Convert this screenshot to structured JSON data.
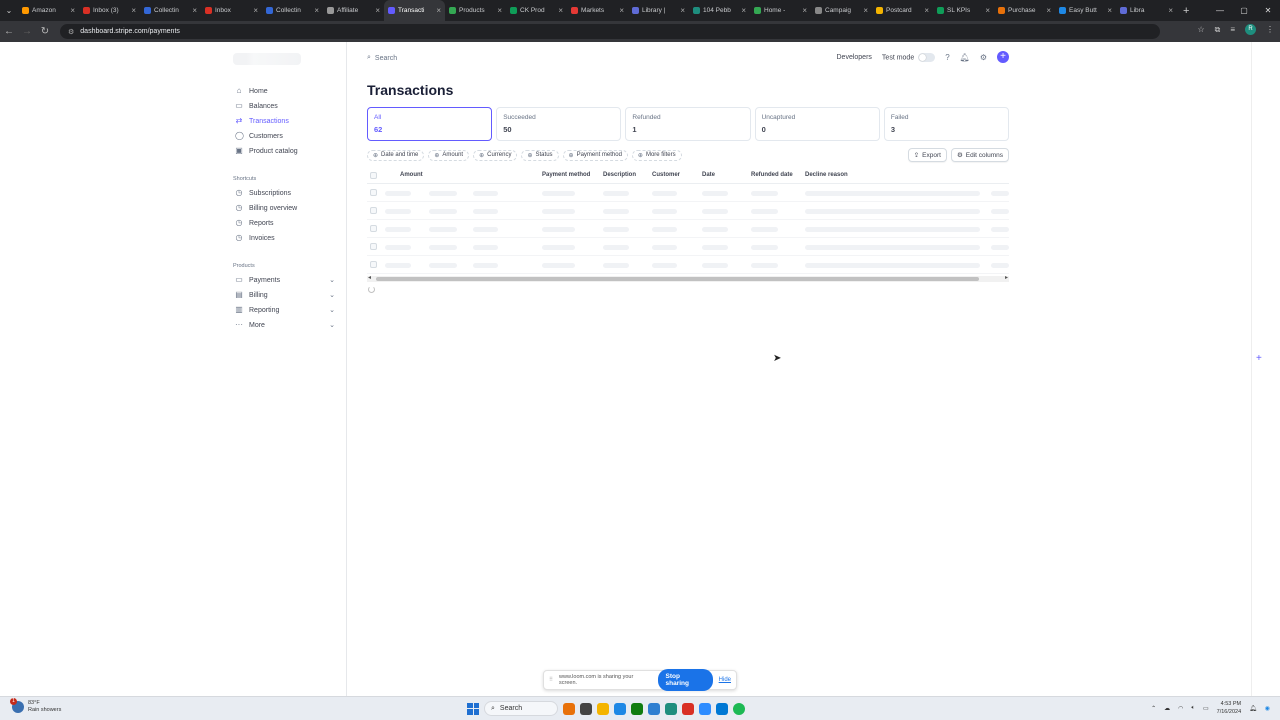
{
  "browser": {
    "tabs": [
      {
        "label": "Amazon",
        "color": "#ff9900"
      },
      {
        "label": "Inbox (3)",
        "color": "#d93025"
      },
      {
        "label": "Collectin",
        "color": "#3367d6"
      },
      {
        "label": "Inbox",
        "color": "#d93025"
      },
      {
        "label": "Collectin",
        "color": "#3367d6"
      },
      {
        "label": "Affiliate",
        "color": "#999999"
      },
      {
        "label": "Transacti",
        "color": "#635bff"
      },
      {
        "label": "Products",
        "color": "#34a853"
      },
      {
        "label": "CK Prod",
        "color": "#0f9d58"
      },
      {
        "label": "Markets",
        "color": "#e53935"
      },
      {
        "label": "Library |",
        "color": "#5f6bd6"
      },
      {
        "label": "104 Pebb",
        "color": "#1e8e7e"
      },
      {
        "label": "Home -",
        "color": "#34a853"
      },
      {
        "label": "Campaig",
        "color": "#888888"
      },
      {
        "label": "Postcard",
        "color": "#f4b400"
      },
      {
        "label": "SL KPIs",
        "color": "#0f9d58"
      },
      {
        "label": "Purchase",
        "color": "#e8710a"
      },
      {
        "label": "Easy Butt",
        "color": "#1e88e5"
      },
      {
        "label": "Libra",
        "color": "#5f6bd6"
      }
    ],
    "active_tab_index": 6,
    "url": "dashboard.stripe.com/payments"
  },
  "sidebar": {
    "main_items": [
      {
        "label": "Home",
        "icon": "home-icon",
        "glyph": "⌂"
      },
      {
        "label": "Balances",
        "icon": "balances-icon",
        "glyph": "▭"
      },
      {
        "label": "Transactions",
        "icon": "transactions-icon",
        "glyph": "⇄"
      },
      {
        "label": "Customers",
        "icon": "customers-icon",
        "glyph": "◯"
      },
      {
        "label": "Product catalog",
        "icon": "catalog-icon",
        "glyph": "▣"
      }
    ],
    "shortcuts_label": "Shortcuts",
    "shortcuts": [
      {
        "label": "Subscriptions"
      },
      {
        "label": "Billing overview"
      },
      {
        "label": "Reports"
      },
      {
        "label": "Invoices"
      }
    ],
    "products_label": "Products",
    "products": [
      {
        "label": "Payments",
        "glyph": "▭"
      },
      {
        "label": "Billing",
        "glyph": "▤"
      },
      {
        "label": "Reporting",
        "glyph": "▥"
      },
      {
        "label": "More",
        "glyph": "···"
      }
    ]
  },
  "topbar": {
    "search_placeholder": "Search",
    "developers": "Developers",
    "test_mode": "Test mode"
  },
  "page_title": "Transactions",
  "status_cards": [
    {
      "label": "All",
      "count": "62"
    },
    {
      "label": "Succeeded",
      "count": "50"
    },
    {
      "label": "Refunded",
      "count": "1"
    },
    {
      "label": "Uncaptured",
      "count": "0"
    },
    {
      "label": "Failed",
      "count": "3"
    }
  ],
  "filters": [
    "Date and time",
    "Amount",
    "Currency",
    "Status",
    "Payment method",
    "More filters"
  ],
  "actions": {
    "export": "Export",
    "edit_columns": "Edit columns"
  },
  "table": {
    "columns": [
      "Amount",
      "Payment method",
      "Description",
      "Customer",
      "Date",
      "Refunded date",
      "Decline reason"
    ],
    "loading_rows": 5
  },
  "loom": {
    "message": "www.loom.com is sharing your screen.",
    "stop": "Stop sharing",
    "hide": "Hide"
  },
  "taskbar": {
    "weather_temp": "83°F",
    "weather_desc": "Rain showers",
    "weather_badge": "1",
    "search": "Search",
    "time": "4:53 PM",
    "date": "7/16/2024"
  },
  "colors": {
    "accent": "#635bff"
  }
}
